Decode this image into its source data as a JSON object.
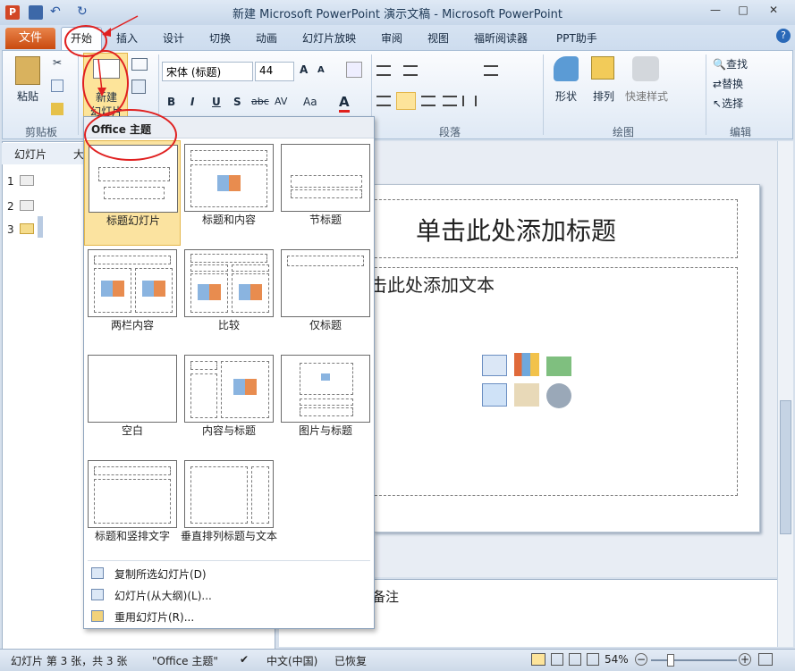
{
  "window": {
    "title": "新建 Microsoft PowerPoint 演示文稿 - Microsoft PowerPoint",
    "min": "—",
    "max": "□",
    "close": "✕"
  },
  "tabs": {
    "file": "文件",
    "home": "开始",
    "insert": "插入",
    "design": "设计",
    "transitions": "切换",
    "animations": "动画",
    "slideshow": "幻灯片放映",
    "review": "审阅",
    "view": "视图",
    "foxit": "福昕阅读器",
    "ppt": "PPT助手"
  },
  "ribbon": {
    "paste": "粘贴",
    "new_slide_1": "新建",
    "new_slide_2": "幻灯片",
    "font_name": "宋体 (标题)",
    "font_size": "44",
    "bold": "B",
    "italic": "I",
    "underline": "U",
    "shadow": "S",
    "strike": "abc",
    "spacing": "AV",
    "case": "Aa",
    "color": "A",
    "shape": "形状",
    "arrange": "排列",
    "quickstyle": "快速样式",
    "find": "查找",
    "replace": "替换",
    "select": "选择",
    "g_clipboard": "剪贴板",
    "g_paragraph": "段落",
    "g_drawing": "绘图",
    "g_editing": "编辑"
  },
  "pane": {
    "tab_slides": "幻灯片",
    "tab_outline": "大",
    "slides": [
      "1",
      "2",
      "3"
    ]
  },
  "slide": {
    "title": "单击此处添加标题",
    "body": "击此处添加文本"
  },
  "notes": {
    "text": "备注"
  },
  "dropdown": {
    "header": "Office 主题",
    "layouts": [
      "标题幻灯片",
      "标题和内容",
      "节标题",
      "两栏内容",
      "比较",
      "仅标题",
      "空白",
      "内容与标题",
      "图片与标题",
      "标题和竖排文字",
      "垂直排列标题与文本"
    ],
    "menu": [
      "复制所选幻灯片(D)",
      "幻灯片(从大纲)(L)...",
      "重用幻灯片(R)..."
    ]
  },
  "status": {
    "slide": "幻灯片 第 3 张，共 3 张",
    "theme": "\"Office 主题\"",
    "lang": "中文(中国)",
    "restored": "已恢复",
    "zoom": "54%"
  },
  "colors": {
    "annotation_red": "#e02020",
    "file_tab": "#d9601f",
    "selected_layout": "#fbe3a0"
  }
}
